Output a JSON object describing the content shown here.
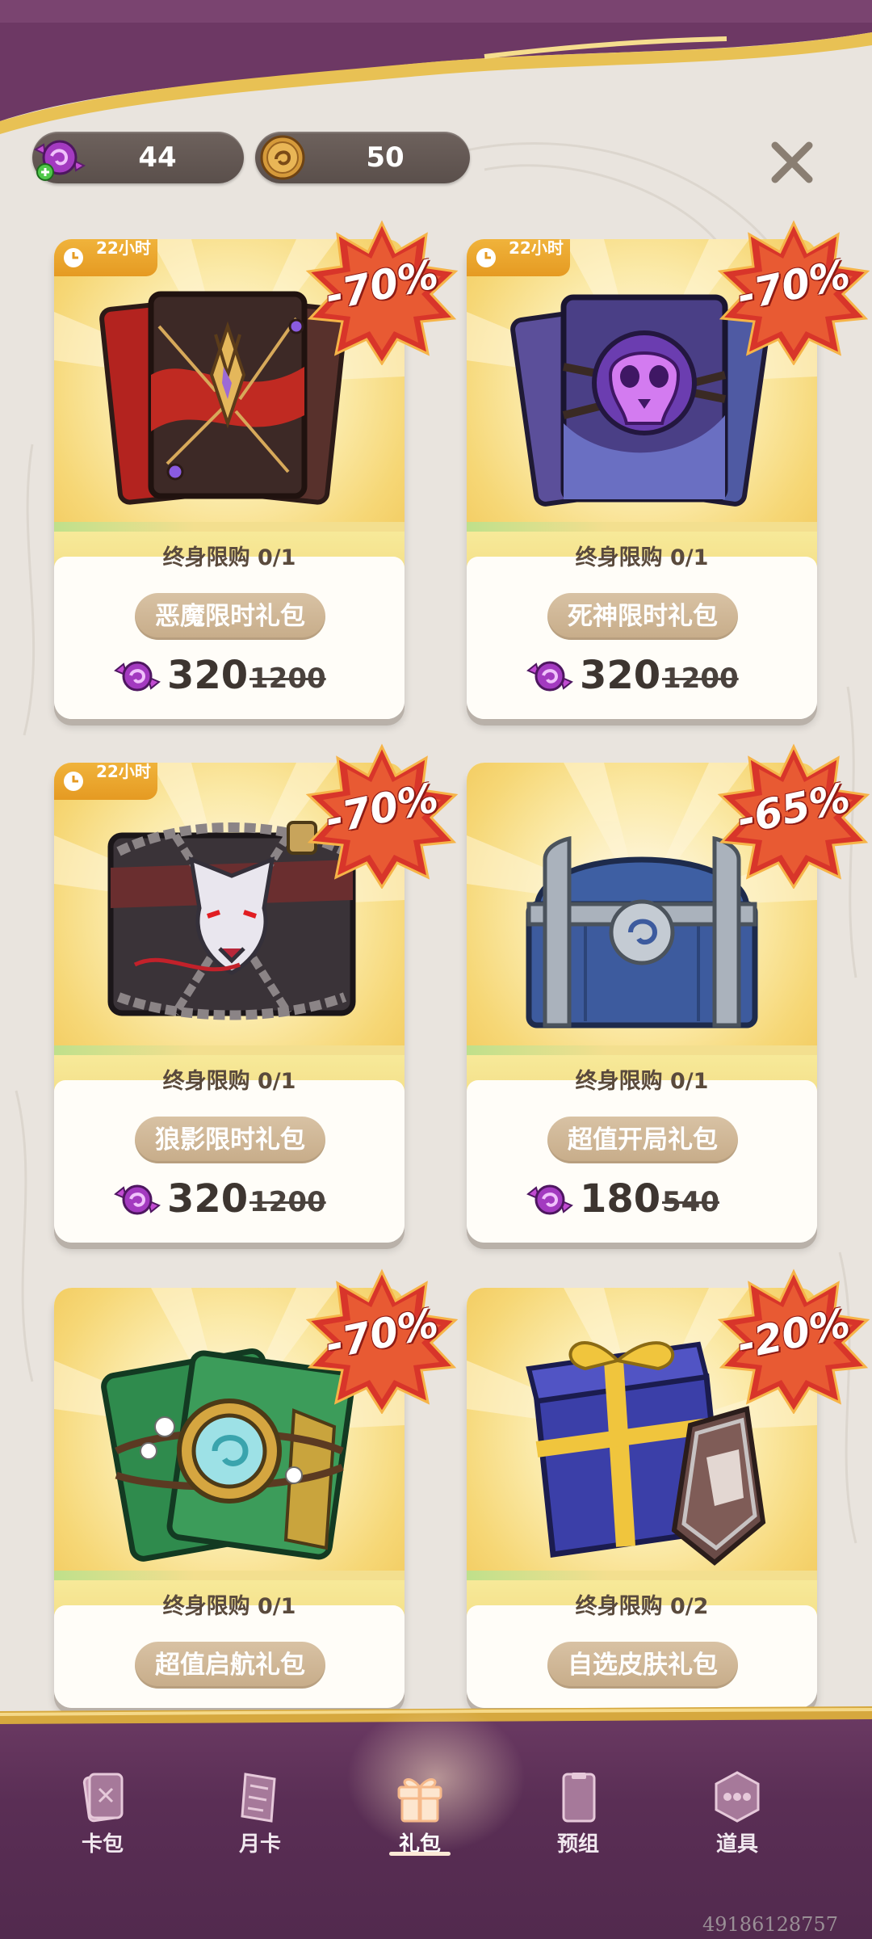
{
  "currency": {
    "candy_amount": "44",
    "coin_amount": "50"
  },
  "packs": [
    {
      "timer": "22小时",
      "discount": "-70%",
      "limit": "终身限购 0/1",
      "name": "恶魔限时礼包",
      "price": "320",
      "original_price": "1200",
      "art_icon": "demon-cards-icon"
    },
    {
      "timer": "22小时",
      "discount": "-70%",
      "limit": "终身限购 0/1",
      "name": "死神限时礼包",
      "price": "320",
      "original_price": "1200",
      "art_icon": "skull-cards-icon"
    },
    {
      "timer": "22小时",
      "discount": "-70%",
      "limit": "终身限购 0/1",
      "name": "狼影限时礼包",
      "price": "320",
      "original_price": "1200",
      "art_icon": "wolf-cards-icon"
    },
    {
      "discount": "-65%",
      "limit": "终身限购 0/1",
      "name": "超值开局礼包",
      "price": "180",
      "original_price": "540",
      "art_icon": "treasure-chest-icon"
    },
    {
      "discount": "-70%",
      "limit": "终身限购 0/1",
      "name": "超值启航礼包",
      "art_icon": "green-cards-icon"
    },
    {
      "discount": "-20%",
      "limit": "终身限购 0/2",
      "name": "自选皮肤礼包",
      "art_icon": "gift-box-shield-icon"
    }
  ],
  "nav": {
    "items": [
      {
        "label": "卡包",
        "icon": "card-pack-icon"
      },
      {
        "label": "月卡",
        "icon": "monthly-card-icon"
      },
      {
        "label": "礼包",
        "icon": "gift-icon",
        "active": true
      },
      {
        "label": "预组",
        "icon": "deck-icon"
      },
      {
        "label": "道具",
        "icon": "items-icon"
      }
    ]
  },
  "watermark": "49186128757",
  "colors": {
    "accent_gold": "#f2c85a",
    "discount_red": "#d8352a",
    "nav_purple": "#5a2e55",
    "pill_tan": "#cdb393"
  }
}
